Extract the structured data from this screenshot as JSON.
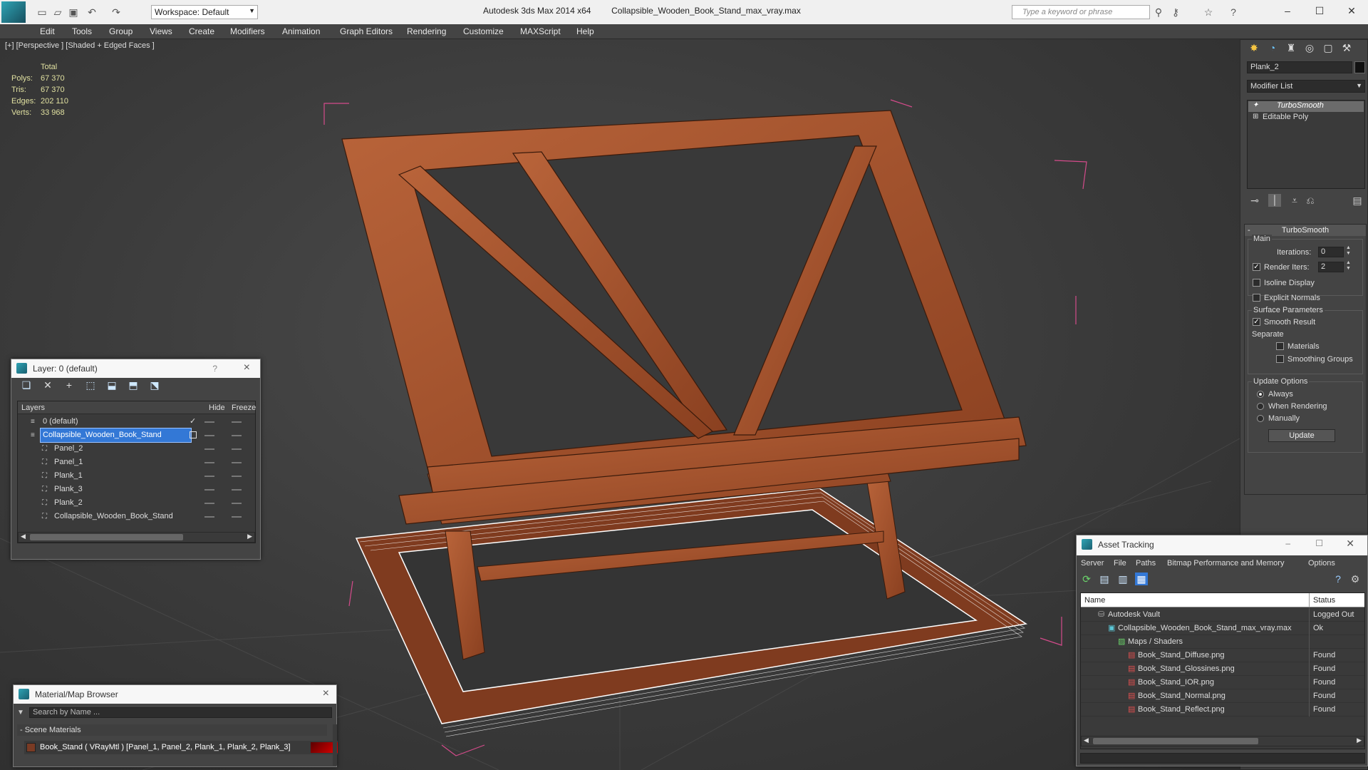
{
  "titlebar": {
    "app_title": "Autodesk 3ds Max  2014 x64",
    "file_title": "Collapsible_Wooden_Book_Stand_max_vray.max",
    "workspace": "Workspace: Default",
    "search_placeholder": "Type a keyword or phrase"
  },
  "menu": [
    "Edit",
    "Tools",
    "Group",
    "Views",
    "Create",
    "Modifiers",
    "Animation",
    "Graph Editors",
    "Rendering",
    "Customize",
    "MAXScript",
    "Help"
  ],
  "viewport": {
    "label": "[+] [Perspective ] [Shaded + Edged Faces ]",
    "stats_header": "Total",
    "stats": [
      {
        "label": "Polys:",
        "value": "67 370"
      },
      {
        "label": "Tris:",
        "value": "67 370"
      },
      {
        "label": "Edges:",
        "value": "202 110"
      },
      {
        "label": "Verts:",
        "value": "33 968"
      }
    ]
  },
  "command_panel": {
    "object_name": "Plank_2",
    "modifier_list": "Modifier List",
    "stack": [
      "TurboSmooth",
      "Editable Poly"
    ],
    "rollout_title": "TurboSmooth",
    "main_label": "Main",
    "iterations_label": "Iterations:",
    "iterations_value": "0",
    "render_iters_label": "Render Iters:",
    "render_iters_value": "2",
    "isoline": "Isoline Display",
    "explicit": "Explicit Normals",
    "surface_label": "Surface Parameters",
    "smooth_result": "Smooth Result",
    "separate_label": "Separate",
    "materials": "Materials",
    "smoothing_groups": "Smoothing Groups",
    "update_options_label": "Update Options",
    "always": "Always",
    "when_rendering": "When Rendering",
    "manually": "Manually",
    "update_button": "Update"
  },
  "layer_window": {
    "title": "Layer: 0 (default)",
    "help": "?",
    "close": "×",
    "col_layers": "Layers",
    "col_hide": "Hide",
    "col_freeze": "Freeze",
    "rows": [
      {
        "name": "0 (default)",
        "indent": 0,
        "selected": false,
        "current": true
      },
      {
        "name": "Collapsible_Wooden_Book_Stand",
        "indent": 0,
        "selected": true,
        "current": false
      },
      {
        "name": "Panel_2",
        "indent": 1,
        "selected": false,
        "current": false
      },
      {
        "name": "Panel_1",
        "indent": 1,
        "selected": false,
        "current": false
      },
      {
        "name": "Plank_1",
        "indent": 1,
        "selected": false,
        "current": false
      },
      {
        "name": "Plank_3",
        "indent": 1,
        "selected": false,
        "current": false
      },
      {
        "name": "Plank_2",
        "indent": 1,
        "selected": false,
        "current": false
      },
      {
        "name": "Collapsible_Wooden_Book_Stand",
        "indent": 1,
        "selected": false,
        "current": false
      }
    ]
  },
  "material_browser": {
    "title": "Material/Map Browser",
    "close": "×",
    "search_placeholder": "Search by Name ...",
    "section": "- Scene Materials",
    "material": "Book_Stand  ( VRayMtl )  [Panel_1, Panel_2, Plank_1, Plank_2, Plank_3]"
  },
  "asset_tracking": {
    "title": "Asset Tracking",
    "menu": [
      "Server",
      "File",
      "Paths",
      "Bitmap Performance and Memory",
      "Options"
    ],
    "col_name": "Name",
    "col_status": "Status",
    "rows": [
      {
        "name": "Autodesk Vault",
        "status": "Logged Out",
        "indent": 1
      },
      {
        "name": "Collapsible_Wooden_Book_Stand_max_vray.max",
        "status": "Ok",
        "indent": 2
      },
      {
        "name": "Maps / Shaders",
        "status": "",
        "indent": 3
      },
      {
        "name": "Book_Stand_Diffuse.png",
        "status": "Found",
        "indent": 4
      },
      {
        "name": "Book_Stand_Glossines.png",
        "status": "Found",
        "indent": 4
      },
      {
        "name": "Book_Stand_IOR.png",
        "status": "Found",
        "indent": 4
      },
      {
        "name": "Book_Stand_Normal.png",
        "status": "Found",
        "indent": 4
      },
      {
        "name": "Book_Stand_Reflect.png",
        "status": "Found",
        "indent": 4
      }
    ]
  },
  "colors": {
    "wood": "#a8532d",
    "wood_dark": "#6b2f17",
    "selection": "#3378d6",
    "bbox": "#d44b8b"
  }
}
